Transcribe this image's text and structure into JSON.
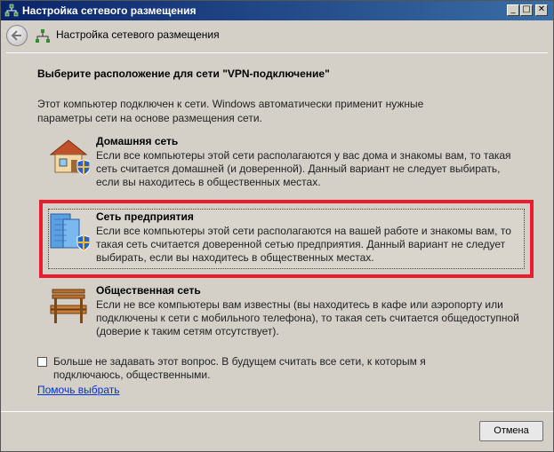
{
  "window": {
    "title": "Настройка сетевого размещения",
    "controls": {
      "minimize": "_",
      "maximize": "□",
      "close": "✕"
    }
  },
  "nav": {
    "title": "Настройка сетевого размещения",
    "back_icon": "back-arrow-icon",
    "title_icon": "network-icon"
  },
  "main": {
    "heading": "Выберите расположение для сети \"VPN-подключение\"",
    "intro": "Этот компьютер подключен к сети. Windows автоматически применит нужные параметры сети на основе размещения сети.",
    "options": [
      {
        "title": "Домашняя сеть",
        "description": "Если все компьютеры этой сети располагаются у вас дома и знакомы вам, то такая сеть считается домашней (и доверенной). Данный вариант не следует выбирать, если вы находитесь в общественных местах.",
        "icon": "house-icon"
      },
      {
        "title": "Сеть предприятия",
        "description": "Если все компьютеры этой сети располагаются на вашей работе и знакомы вам, то такая сеть считается доверенной сетью предприятия. Данный вариант не следует выбирать, если вы находитесь в общественных местах.",
        "icon": "office-building-icon"
      },
      {
        "title": "Общественная сеть",
        "description": "Если не все компьютеры вам известны (вы находитесь в кафе или аэропорту или подключены к сети с мобильного телефона), то такая сеть считается общедоступной (доверие к таким сетям отсутствует).",
        "icon": "bench-icon"
      }
    ],
    "checkbox_label": "Больше не задавать этот вопрос. В будущем считать все сети, к которым я подключаюсь, общественными.",
    "help_link": "Помочь выбрать"
  },
  "footer": {
    "cancel_label": "Отмена"
  },
  "colors": {
    "selection_border": "#e81e2c",
    "link": "#0033cc",
    "titlebar": "#0a246a"
  }
}
